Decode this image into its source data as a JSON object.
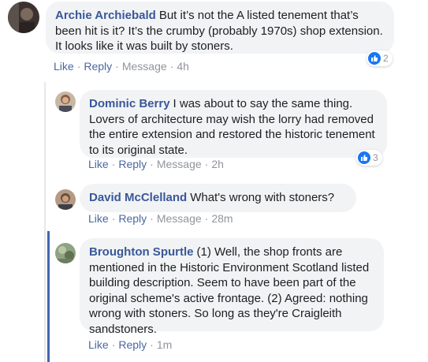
{
  "comments": [
    {
      "author": "Archie Archiebald",
      "text": "But it’s not the A listed tenement that’s been hit is it? It’s the crumby (probably 1970s) shop extension. It looks like it was built by stoners.",
      "actions": {
        "like": "Like",
        "reply": "Reply",
        "message": "Message",
        "time": "4h"
      },
      "reaction_count": "2"
    },
    {
      "author": "Dominic Berry",
      "text": "I was about to say the same thing. Lovers of architecture may wish the lorry had removed the entire extension and restored the historic tenement to its original state.",
      "actions": {
        "like": "Like",
        "reply": "Reply",
        "message": "Message",
        "time": "2h"
      },
      "reaction_count": "3"
    },
    {
      "author": "David McClelland",
      "text": "What's wrong with stoners?",
      "actions": {
        "like": "Like",
        "reply": "Reply",
        "message": "Message",
        "time": "28m"
      }
    },
    {
      "author": "Broughton Spurtle",
      "text": "(1) Well, the shop fronts are mentioned in the Historic Environment Scotland listed building description. Seem to have been part of the original scheme's active frontage. (2) Agreed: nothing wrong with stoners. So long as they're Craigleith sandstoners.",
      "actions": {
        "like": "Like",
        "reply": "Reply",
        "time": "1m"
      }
    }
  ],
  "colors": {
    "bubble": "#f2f3f5",
    "author": "#385898",
    "link": "#4b67a1",
    "meta": "#90949c",
    "like_badge": "#1877f2"
  }
}
